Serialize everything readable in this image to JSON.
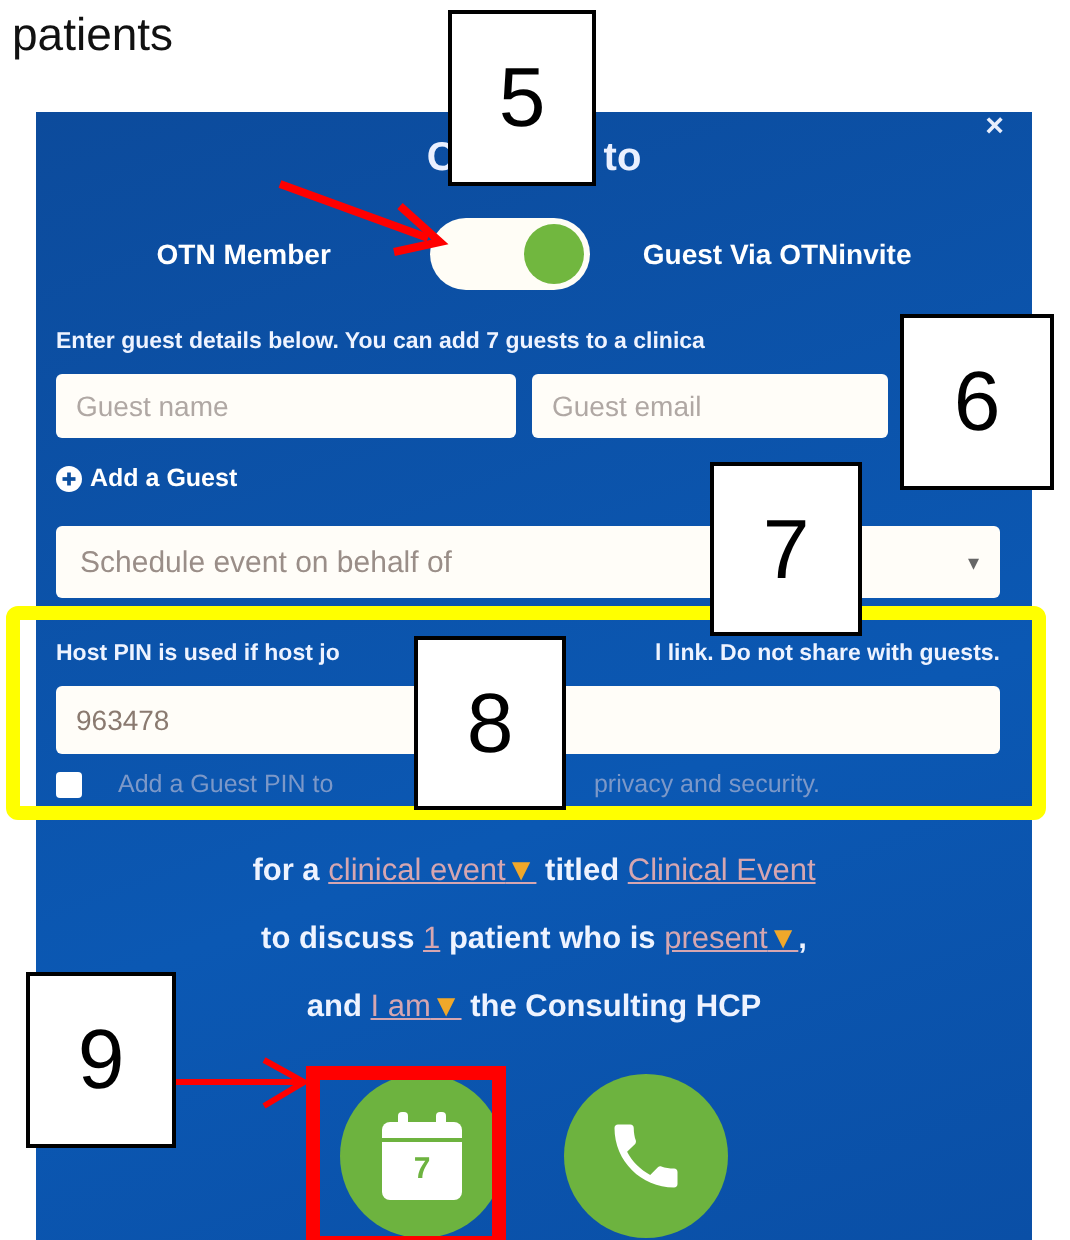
{
  "caption": "patients",
  "dialog": {
    "close": "×",
    "title_parts": [
      "C",
      "to"
    ],
    "toggle": {
      "left_label": "OTN Member",
      "right_label": "Guest Via OTNinvite",
      "on": true
    },
    "instructions": "Enter guest details below. You can add 7 guests to a clinica",
    "fields": [
      {
        "placeholder": "Guest name"
      },
      {
        "placeholder": "Guest email"
      }
    ],
    "add_guest": "Add a Guest",
    "select": {
      "placeholder": "Schedule event on behalf of",
      "caret": "▾"
    },
    "pin_hint_parts": [
      "Host PIN is used if host jo",
      "l link. Do not share with guests."
    ],
    "pin": {
      "value": "963478"
    },
    "guest_pin": {
      "checked": false,
      "label_parts": [
        "Add a Guest PIN to",
        "privacy and security."
      ]
    },
    "summary": [
      [
        {
          "kind": "text",
          "text": "for a"
        },
        {
          "kind": "dropdown",
          "text": "clinical event",
          "caret": "▼"
        },
        {
          "kind": "text",
          "text": "titled"
        },
        {
          "kind": "link",
          "text": "Clinical Event"
        }
      ],
      [
        {
          "kind": "text",
          "text": "to discuss"
        },
        {
          "kind": "link",
          "text": "1"
        },
        {
          "kind": "text",
          "text": "patient who is"
        },
        {
          "kind": "dropdown",
          "text": "present",
          "caret": "▼"
        },
        {
          "kind": "punct",
          "text": ","
        }
      ],
      [
        {
          "kind": "text",
          "text": "and"
        },
        {
          "kind": "dropdown",
          "text": "I am",
          "caret": "▼"
        },
        {
          "kind": "text",
          "text": "the Consulting HCP"
        }
      ]
    ],
    "actions": [
      {
        "kind": "calendar",
        "day": "7"
      },
      {
        "kind": "phone"
      }
    ]
  },
  "annotations": {
    "callouts": [
      "5",
      "6",
      "7",
      "8",
      "9"
    ]
  }
}
